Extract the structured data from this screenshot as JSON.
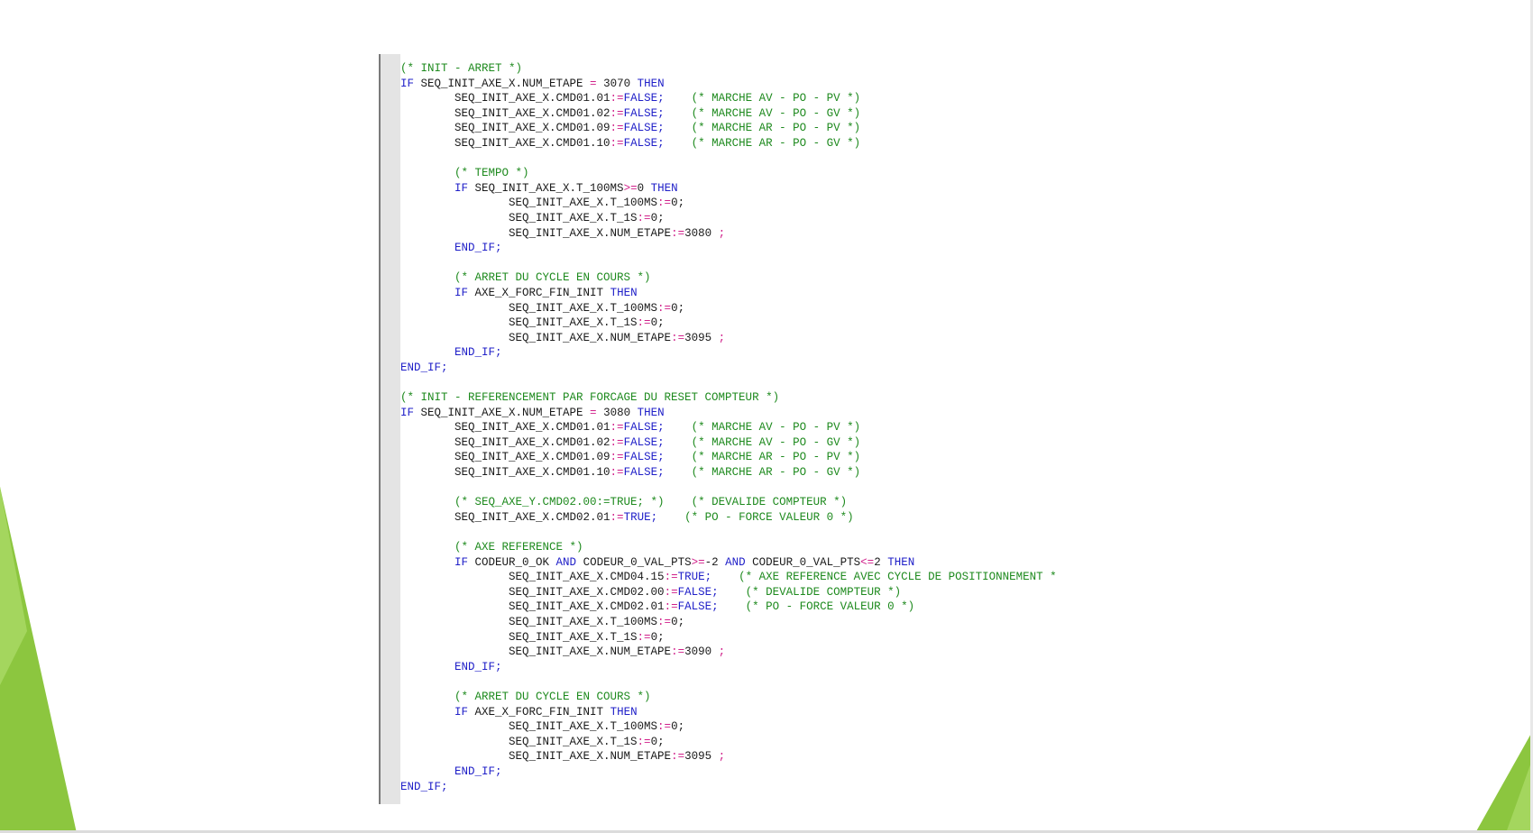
{
  "code_lines": [
    [
      [
        "cm",
        "(* INIT - ARRET *)"
      ]
    ],
    [
      [
        "kw",
        "IF "
      ],
      [
        "id",
        "SEQ_INIT_AXE_X.NUM_ETAPE "
      ],
      [
        "op",
        "="
      ],
      [
        "id",
        " 3070 "
      ],
      [
        "kw",
        "THEN"
      ]
    ],
    [
      [
        "id",
        "        SEQ_INIT_AXE_X.CMD01.01"
      ],
      [
        "op",
        ":="
      ],
      [
        "kw",
        "FALSE;"
      ],
      [
        "id",
        "    "
      ],
      [
        "cm",
        "(* MARCHE AV - PO - PV *)"
      ]
    ],
    [
      [
        "id",
        "        SEQ_INIT_AXE_X.CMD01.02"
      ],
      [
        "op",
        ":="
      ],
      [
        "kw",
        "FALSE;"
      ],
      [
        "id",
        "    "
      ],
      [
        "cm",
        "(* MARCHE AV - PO - GV *)"
      ]
    ],
    [
      [
        "id",
        "        SEQ_INIT_AXE_X.CMD01.09"
      ],
      [
        "op",
        ":="
      ],
      [
        "kw",
        "FALSE;"
      ],
      [
        "id",
        "    "
      ],
      [
        "cm",
        "(* MARCHE AR - PO - PV *)"
      ]
    ],
    [
      [
        "id",
        "        SEQ_INIT_AXE_X.CMD01.10"
      ],
      [
        "op",
        ":="
      ],
      [
        "kw",
        "FALSE;"
      ],
      [
        "id",
        "    "
      ],
      [
        "cm",
        "(* MARCHE AR - PO - GV *)"
      ]
    ],
    [],
    [
      [
        "id",
        "        "
      ],
      [
        "cm",
        "(* TEMPO *)"
      ]
    ],
    [
      [
        "id",
        "        "
      ],
      [
        "kw",
        "IF "
      ],
      [
        "id",
        "SEQ_INIT_AXE_X.T_100MS"
      ],
      [
        "op",
        ">="
      ],
      [
        "id",
        "0 "
      ],
      [
        "kw",
        "THEN"
      ]
    ],
    [
      [
        "id",
        "                SEQ_INIT_AXE_X.T_100MS"
      ],
      [
        "op",
        ":="
      ],
      [
        "id",
        "0;"
      ]
    ],
    [
      [
        "id",
        "                SEQ_INIT_AXE_X.T_1S"
      ],
      [
        "op",
        ":="
      ],
      [
        "id",
        "0;"
      ]
    ],
    [
      [
        "id",
        "                SEQ_INIT_AXE_X.NUM_ETAPE"
      ],
      [
        "op",
        ":="
      ],
      [
        "id",
        "3080 "
      ],
      [
        "op",
        ";"
      ]
    ],
    [
      [
        "id",
        "        "
      ],
      [
        "kw",
        "END_IF;"
      ]
    ],
    [],
    [
      [
        "id",
        "        "
      ],
      [
        "cm",
        "(* ARRET DU CYCLE EN COURS *)"
      ]
    ],
    [
      [
        "id",
        "        "
      ],
      [
        "kw",
        "IF "
      ],
      [
        "id",
        "AXE_X_FORC_FIN_INIT "
      ],
      [
        "kw",
        "THEN"
      ]
    ],
    [
      [
        "id",
        "                SEQ_INIT_AXE_X.T_100MS"
      ],
      [
        "op",
        ":="
      ],
      [
        "id",
        "0;"
      ]
    ],
    [
      [
        "id",
        "                SEQ_INIT_AXE_X.T_1S"
      ],
      [
        "op",
        ":="
      ],
      [
        "id",
        "0;"
      ]
    ],
    [
      [
        "id",
        "                SEQ_INIT_AXE_X.NUM_ETAPE"
      ],
      [
        "op",
        ":="
      ],
      [
        "id",
        "3095 "
      ],
      [
        "op",
        ";"
      ]
    ],
    [
      [
        "id",
        "        "
      ],
      [
        "kw",
        "END_IF;"
      ]
    ],
    [
      [
        "kw",
        "END_IF;"
      ]
    ],
    [],
    [
      [
        "cm",
        "(* INIT - REFERENCEMENT PAR FORCAGE DU RESET COMPTEUR *)"
      ]
    ],
    [
      [
        "kw",
        "IF "
      ],
      [
        "id",
        "SEQ_INIT_AXE_X.NUM_ETAPE "
      ],
      [
        "op",
        "="
      ],
      [
        "id",
        " 3080 "
      ],
      [
        "kw",
        "THEN"
      ]
    ],
    [
      [
        "id",
        "        SEQ_INIT_AXE_X.CMD01.01"
      ],
      [
        "op",
        ":="
      ],
      [
        "kw",
        "FALSE;"
      ],
      [
        "id",
        "    "
      ],
      [
        "cm",
        "(* MARCHE AV - PO - PV *)"
      ]
    ],
    [
      [
        "id",
        "        SEQ_INIT_AXE_X.CMD01.02"
      ],
      [
        "op",
        ":="
      ],
      [
        "kw",
        "FALSE;"
      ],
      [
        "id",
        "    "
      ],
      [
        "cm",
        "(* MARCHE AV - PO - GV *)"
      ]
    ],
    [
      [
        "id",
        "        SEQ_INIT_AXE_X.CMD01.09"
      ],
      [
        "op",
        ":="
      ],
      [
        "kw",
        "FALSE;"
      ],
      [
        "id",
        "    "
      ],
      [
        "cm",
        "(* MARCHE AR - PO - PV *)"
      ]
    ],
    [
      [
        "id",
        "        SEQ_INIT_AXE_X.CMD01.10"
      ],
      [
        "op",
        ":="
      ],
      [
        "kw",
        "FALSE;"
      ],
      [
        "id",
        "    "
      ],
      [
        "cm",
        "(* MARCHE AR - PO - GV *)"
      ]
    ],
    [],
    [
      [
        "id",
        "        "
      ],
      [
        "cm",
        "(* SEQ_AXE_Y.CMD02.00:=TRUE; *)"
      ],
      [
        "id",
        "    "
      ],
      [
        "cm",
        "(* DEVALIDE COMPTEUR *)"
      ]
    ],
    [
      [
        "id",
        "        SEQ_INIT_AXE_X.CMD02.01"
      ],
      [
        "op",
        ":="
      ],
      [
        "kw",
        "TRUE;"
      ],
      [
        "id",
        "    "
      ],
      [
        "cm",
        "(* PO - FORCE VALEUR 0 *)"
      ]
    ],
    [],
    [
      [
        "id",
        "        "
      ],
      [
        "cm",
        "(* AXE REFERENCE *)"
      ]
    ],
    [
      [
        "id",
        "        "
      ],
      [
        "kw",
        "IF "
      ],
      [
        "id",
        "CODEUR_0_OK "
      ],
      [
        "kw",
        "AND "
      ],
      [
        "id",
        "CODEUR_0_VAL_PTS"
      ],
      [
        "op",
        ">="
      ],
      [
        "id",
        "-2 "
      ],
      [
        "kw",
        "AND "
      ],
      [
        "id",
        "CODEUR_0_VAL_PTS"
      ],
      [
        "op",
        "<="
      ],
      [
        "id",
        "2 "
      ],
      [
        "kw",
        "THEN"
      ]
    ],
    [
      [
        "id",
        "                SEQ_INIT_AXE_X.CMD04.15"
      ],
      [
        "op",
        ":="
      ],
      [
        "kw",
        "TRUE;"
      ],
      [
        "id",
        "    "
      ],
      [
        "cm",
        "(* AXE REFERENCE AVEC CYCLE DE POSITIONNEMENT *"
      ]
    ],
    [
      [
        "id",
        "                SEQ_INIT_AXE_X.CMD02.00"
      ],
      [
        "op",
        ":="
      ],
      [
        "kw",
        "FALSE;"
      ],
      [
        "id",
        "    "
      ],
      [
        "cm",
        "(* DEVALIDE COMPTEUR *)"
      ]
    ],
    [
      [
        "id",
        "                SEQ_INIT_AXE_X.CMD02.01"
      ],
      [
        "op",
        ":="
      ],
      [
        "kw",
        "FALSE;"
      ],
      [
        "id",
        "    "
      ],
      [
        "cm",
        "(* PO - FORCE VALEUR 0 *)"
      ]
    ],
    [
      [
        "id",
        "                SEQ_INIT_AXE_X.T_100MS"
      ],
      [
        "op",
        ":="
      ],
      [
        "id",
        "0;"
      ]
    ],
    [
      [
        "id",
        "                SEQ_INIT_AXE_X.T_1S"
      ],
      [
        "op",
        ":="
      ],
      [
        "id",
        "0;"
      ]
    ],
    [
      [
        "id",
        "                SEQ_INIT_AXE_X.NUM_ETAPE"
      ],
      [
        "op",
        ":="
      ],
      [
        "id",
        "3090 "
      ],
      [
        "op",
        ";"
      ]
    ],
    [
      [
        "id",
        "        "
      ],
      [
        "kw",
        "END_IF;"
      ]
    ],
    [],
    [
      [
        "id",
        "        "
      ],
      [
        "cm",
        "(* ARRET DU CYCLE EN COURS *)"
      ]
    ],
    [
      [
        "id",
        "        "
      ],
      [
        "kw",
        "IF "
      ],
      [
        "id",
        "AXE_X_FORC_FIN_INIT "
      ],
      [
        "kw",
        "THEN"
      ]
    ],
    [
      [
        "id",
        "                SEQ_INIT_AXE_X.T_100MS"
      ],
      [
        "op",
        ":="
      ],
      [
        "id",
        "0;"
      ]
    ],
    [
      [
        "id",
        "                SEQ_INIT_AXE_X.T_1S"
      ],
      [
        "op",
        ":="
      ],
      [
        "id",
        "0;"
      ]
    ],
    [
      [
        "id",
        "                SEQ_INIT_AXE_X.NUM_ETAPE"
      ],
      [
        "op",
        ":="
      ],
      [
        "id",
        "3095 "
      ],
      [
        "op",
        ";"
      ]
    ],
    [
      [
        "id",
        "        "
      ],
      [
        "kw",
        "END_IF;"
      ]
    ],
    [
      [
        "kw",
        "END_IF;"
      ]
    ]
  ],
  "colors": {
    "keyword": "#2020c8",
    "operator": "#d0208a",
    "comment": "#1e8a1e",
    "identifier": "#1a1a1a",
    "accent_green": "#8cc63f"
  },
  "decor": {
    "left_triangle": "green-accent-triangle",
    "right_triangle": "green-accent-triangle"
  }
}
